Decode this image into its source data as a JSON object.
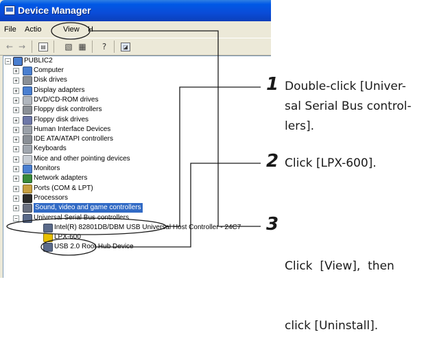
{
  "window": {
    "title": "Device Manager"
  },
  "menu": {
    "file": "File",
    "action": "Actio",
    "view": "View",
    "help": "H"
  },
  "toolbar": {
    "icons": [
      "back-arrow-icon",
      "forward-arrow-icon",
      "tree-view-icon",
      "properties-icon",
      "print-icon",
      "help-icon",
      "scan-icon"
    ]
  },
  "tree": {
    "root": "PUBLIC2",
    "items": [
      {
        "label": "Computer",
        "icon": "computer-icon",
        "color": "#4a7fd0"
      },
      {
        "label": "Disk drives",
        "icon": "disk-drive-icon",
        "color": "#8a8f96"
      },
      {
        "label": "Display adapters",
        "icon": "display-adapter-icon",
        "color": "#4a7fd0"
      },
      {
        "label": "DVD/CD-ROM drives",
        "icon": "dvd-drive-icon",
        "color": "#b0b6be"
      },
      {
        "label": "Floppy disk controllers",
        "icon": "floppy-controller-icon",
        "color": "#8a8f96"
      },
      {
        "label": "Floppy disk drives",
        "icon": "floppy-drive-icon",
        "color": "#6e78a8"
      },
      {
        "label": "Human Interface Devices",
        "icon": "hid-icon",
        "color": "#9aa0a8"
      },
      {
        "label": "IDE ATA/ATAPI controllers",
        "icon": "ide-controller-icon",
        "color": "#8a8f96"
      },
      {
        "label": "Keyboards",
        "icon": "keyboard-icon",
        "color": "#a0a6ae"
      },
      {
        "label": "Mice and other pointing devices",
        "icon": "mouse-icon",
        "color": "#c8cdd4"
      },
      {
        "label": "Monitors",
        "icon": "monitor-icon",
        "color": "#4a7fd0"
      },
      {
        "label": "Network adapters",
        "icon": "network-adapter-icon",
        "color": "#3a8a3a"
      },
      {
        "label": "Ports (COM & LPT)",
        "icon": "port-icon",
        "color": "#c8a040"
      },
      {
        "label": "Processors",
        "icon": "processor-icon",
        "color": "#2a2a2a"
      },
      {
        "label": "Sound, video and game controllers",
        "icon": "sound-icon",
        "color": "#6a7080",
        "selected": true
      },
      {
        "label": "Universal Serial Bus controllers",
        "icon": "usb-icon",
        "color": "#5a6a8a",
        "expanded": true
      },
      {
        "label": "Intel(R) 82801DB/DBM USB Universal Host Controller - 24C7",
        "icon": "usb-device-icon",
        "color": "#5a6a8a",
        "child": true
      },
      {
        "label": "LPX-600",
        "icon": "warning-device-icon",
        "color": "#e8c000",
        "child": true
      },
      {
        "label": "USB 2.0 Root Hub Device",
        "icon": "usb-device-icon",
        "color": "#5a6a8a",
        "child": true
      }
    ]
  },
  "steps": [
    {
      "number": "1",
      "lines": [
        "Double-click [Univer-",
        "sal Serial Bus control-",
        "lers]."
      ]
    },
    {
      "number": "2",
      "lines": [
        "Click [LPX-600]."
      ]
    },
    {
      "number": "3",
      "lines": [
        "Click  [View],  then",
        "click [Uninstall]."
      ]
    }
  ]
}
